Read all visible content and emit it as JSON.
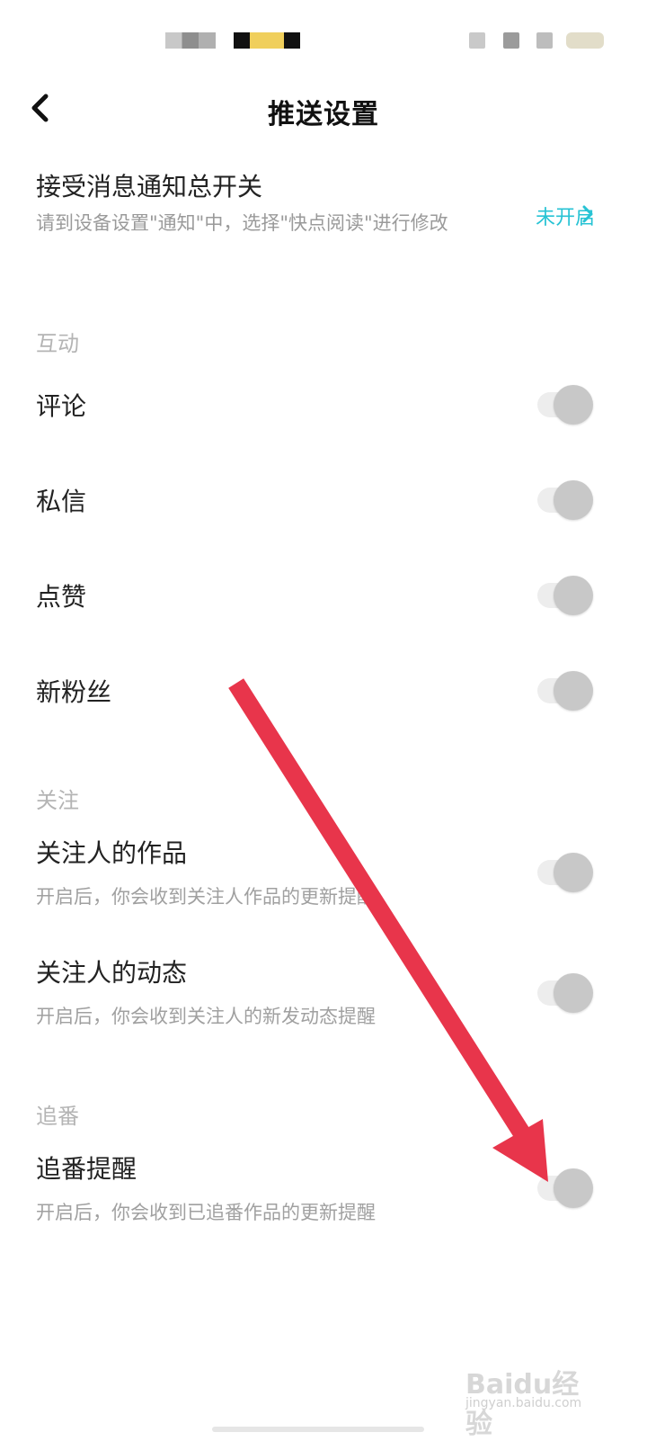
{
  "header": {
    "title": "推送设置"
  },
  "master": {
    "title": "接受消息通知总开关",
    "description": "请到设备设置\"通知\"中，选择\"快点阅读\"进行修改",
    "status": "未开启",
    "status_color": "#27c3d4"
  },
  "sections": [
    {
      "label": "互动",
      "items": [
        {
          "title": "评论",
          "enabled": false
        },
        {
          "title": "私信",
          "enabled": false
        },
        {
          "title": "点赞",
          "enabled": false
        },
        {
          "title": "新粉丝",
          "enabled": false
        }
      ]
    },
    {
      "label": "关注",
      "items": [
        {
          "title": "关注人的作品",
          "description": "开启后，你会收到关注人作品的更新提醒",
          "enabled": false
        },
        {
          "title": "关注人的动态",
          "description": "开启后，你会收到关注人的新发动态提醒",
          "enabled": false
        }
      ]
    },
    {
      "label": "追番",
      "items": [
        {
          "title": "追番提醒",
          "description": "开启后，你会收到已追番作品的更新提醒",
          "enabled": false
        }
      ]
    }
  ],
  "annotation": {
    "arrow_color": "#e8354b"
  },
  "watermark": {
    "text": "Baidu经验",
    "sub": "jingyan.baidu.com"
  }
}
